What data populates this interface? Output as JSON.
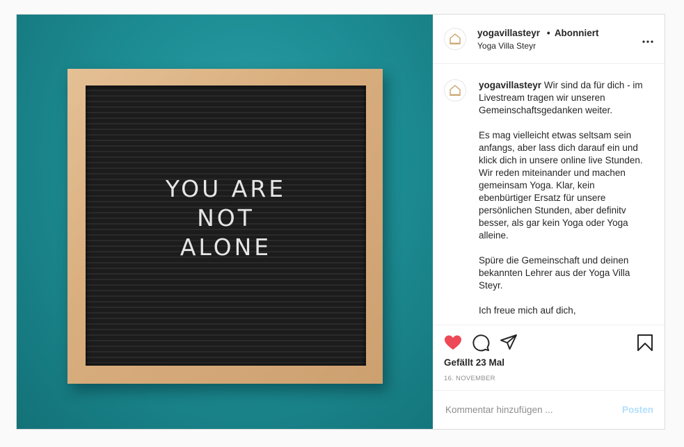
{
  "post": {
    "image": {
      "board_lines": [
        "YOU ARE",
        "NOT",
        "ALONE"
      ]
    },
    "header": {
      "username": "yogavillasteyr",
      "follow_state": "Abonniert",
      "location": "Yoga Villa Steyr",
      "more_icon": "more-dots-icon"
    },
    "caption": {
      "username": "yogavillasteyr",
      "paragraphs": [
        "Wir sind da für dich - im Livestream tragen wir unseren Gemeinschaftsgedanken weiter.",
        "Es mag vielleicht etwas seltsam sein anfangs, aber lass dich darauf ein und klick dich in unsere online live Stunden. Wir reden miteinander und machen gemeinsam Yoga. Klar, kein ebenbürtiger Ersatz für unsere persönlichen Stunden, aber definitv besser, als gar kein Yoga oder Yoga alleine.",
        "Spüre die Gemeinschaft und deinen bekannten Lehrer aus der Yoga Villa Steyr.",
        "Ich freue mich auf dich,"
      ]
    },
    "actions": {
      "like_icon": "heart-filled-icon",
      "comment_icon": "comment-icon",
      "share_icon": "share-icon",
      "save_icon": "bookmark-icon",
      "like_color": "#ed4956",
      "likes_text": "Gefällt 23 Mal",
      "date": "16. NOVEMBER"
    },
    "comment_box": {
      "placeholder": "Kommentar hinzufügen ...",
      "post_label": "Posten",
      "post_color": "#b2dffc"
    }
  }
}
